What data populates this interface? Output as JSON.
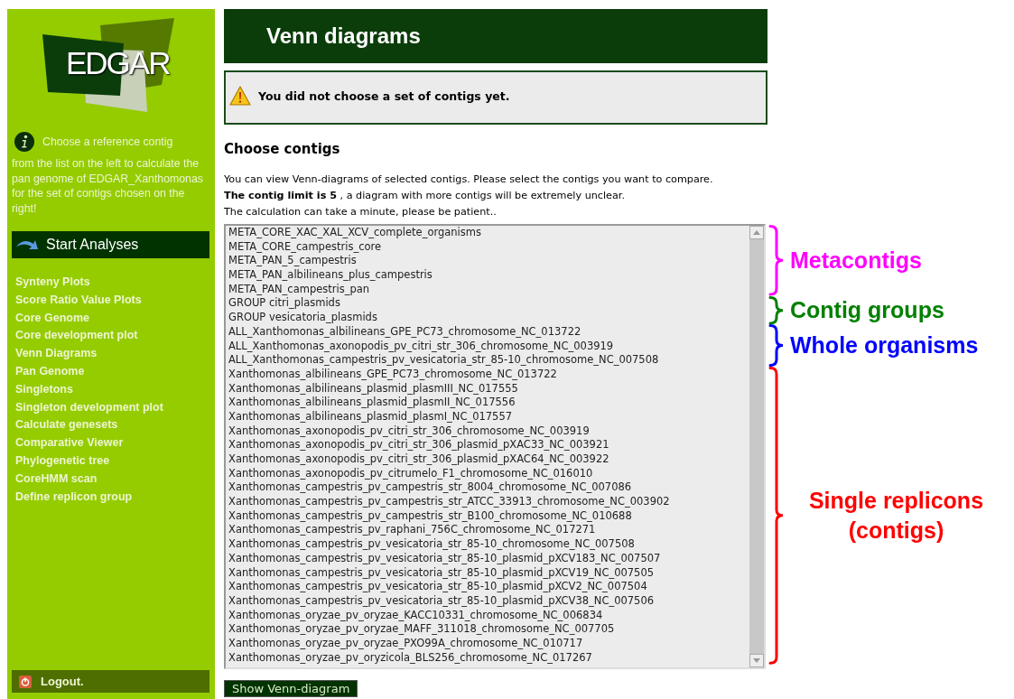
{
  "sidebar": {
    "logo": "EDGAR",
    "info_title": "Choose a reference contig",
    "info": "from the list on the left to calculate the pan genome of EDGAR_Xanthomonas for the set of contigs chosen on the right!",
    "section_title": "Start Analyses",
    "menu": [
      "Synteny Plots",
      "Score Ratio Value Plots",
      "Core Genome",
      "Core development plot",
      "Venn Diagrams",
      "Pan Genome",
      "Singletons",
      "Singleton development plot",
      "Calculate genesets",
      "Comparative Viewer",
      "Phylogenetic tree",
      "CoreHMM scan",
      "Define replicon group"
    ],
    "logout": "Logout."
  },
  "page_title": "Venn diagrams",
  "warning": "You did not choose a set of contigs yet.",
  "section_heading": "Choose contigs",
  "intro": [
    "You can view Venn-diagrams of selected contigs. Please select the contigs you want to compare.",
    "**The contig limit is 5** , a diagram with more contigs will be extremely unclear.",
    "The calculation can take a minute, please be patient.."
  ],
  "contig_list": {
    "groups": [
      {
        "label": "Metacontigs",
        "color": "#ff00ff",
        "items": [
          "META_CORE_XAC_XAL_XCV_complete_organisms",
          "META_CORE_campestris_core",
          "META_PAN_5_campestris",
          "META_PAN_albilineans_plus_campestris",
          "META_PAN_campestris_pan"
        ]
      },
      {
        "label": "Contig groups",
        "color": "#008000",
        "items": [
          "GROUP citri_plasmids",
          "GROUP vesicatoria_plasmids"
        ]
      },
      {
        "label": "Whole organisms",
        "color": "#0000ff",
        "items": [
          "ALL_Xanthomonas_albilineans_GPE_PC73_chromosome_NC_013722",
          "ALL_Xanthomonas_axonopodis_pv_citri_str_306_chromosome_NC_003919",
          "ALL_Xanthomonas_campestris_pv_vesicatoria_str_85-10_chromosome_NC_007508"
        ]
      },
      {
        "label": "Single replicons (contigs)",
        "color": "#ff0000",
        "items": [
          "Xanthomonas_albilineans_GPE_PC73_chromosome_NC_013722",
          "Xanthomonas_albilineans_plasmid_plasmIII_NC_017555",
          "Xanthomonas_albilineans_plasmid_plasmII_NC_017556",
          "Xanthomonas_albilineans_plasmid_plasmI_NC_017557",
          "Xanthomonas_axonopodis_pv_citri_str_306_chromosome_NC_003919",
          "Xanthomonas_axonopodis_pv_citri_str_306_plasmid_pXAC33_NC_003921",
          "Xanthomonas_axonopodis_pv_citri_str_306_plasmid_pXAC64_NC_003922",
          "Xanthomonas_axonopodis_pv_citrumelo_F1_chromosome_NC_016010",
          "Xanthomonas_campestris_pv_campestris_str_8004_chromosome_NC_007086",
          "Xanthomonas_campestris_pv_campestris_str_ATCC_33913_chromosome_NC_003902",
          "Xanthomonas_campestris_pv_campestris_str_B100_chromosome_NC_010688",
          "Xanthomonas_campestris_pv_raphani_756C_chromosome_NC_017271",
          "Xanthomonas_campestris_pv_vesicatoria_str_85-10_chromosome_NC_007508",
          "Xanthomonas_campestris_pv_vesicatoria_str_85-10_plasmid_pXCV183_NC_007507",
          "Xanthomonas_campestris_pv_vesicatoria_str_85-10_plasmid_pXCV19_NC_007505",
          "Xanthomonas_campestris_pv_vesicatoria_str_85-10_plasmid_pXCV2_NC_007504",
          "Xanthomonas_campestris_pv_vesicatoria_str_85-10_plasmid_pXCV38_NC_007506",
          "Xanthomonas_oryzae_pv_oryzae_KACC10331_chromosome_NC_006834",
          "Xanthomonas_oryzae_pv_oryzae_MAFF_311018_chromosome_NC_007705",
          "Xanthomonas_oryzae_pv_oryzae_PXO99A_chromosome_NC_010717",
          "Xanthomonas_oryzae_pv_oryzicola_BLS256_chromosome_NC_017267"
        ]
      }
    ]
  },
  "submit_button": "Show Venn-diagram"
}
